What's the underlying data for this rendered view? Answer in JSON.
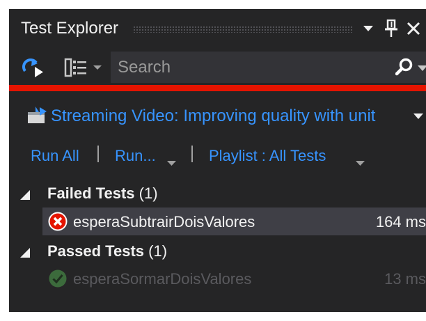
{
  "window": {
    "title": "Test Explorer"
  },
  "toolbar": {
    "search": {
      "placeholder": "Search",
      "value": ""
    }
  },
  "project": {
    "label": "Streaming Video: Improving quality with unit"
  },
  "actions": {
    "run_all": "Run All",
    "run": "Run...",
    "playlist": "Playlist : All Tests"
  },
  "groups": {
    "failed": {
      "label": "Failed Tests",
      "count": "(1)",
      "tests": [
        {
          "name": "esperaSubtrairDoisValores",
          "duration": "164 ms"
        }
      ]
    },
    "passed": {
      "label": "Passed Tests",
      "count": "(1)",
      "tests": [
        {
          "name": "esperaSormarDoisValores",
          "duration": "13 ms"
        }
      ]
    }
  },
  "colors": {
    "background": "#252526",
    "link": "#3794ff",
    "fail_bar": "#e51400",
    "fail_icon": "#e51400",
    "pass_icon": "#3c6b3c",
    "selected_row": "#3f3f46"
  }
}
